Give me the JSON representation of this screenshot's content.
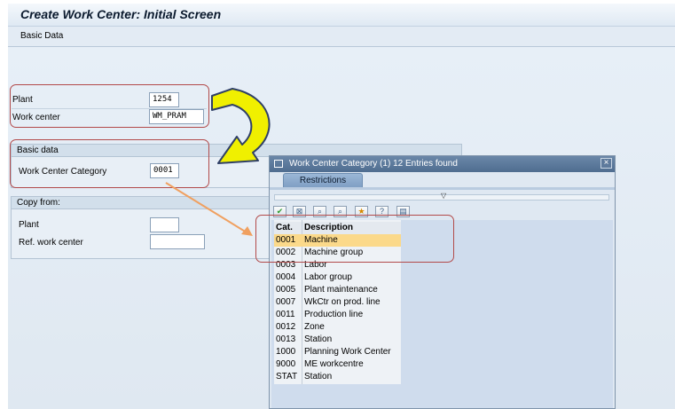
{
  "window": {
    "title": "Create Work Center: Initial Screen"
  },
  "toolbar": {
    "basic_data_label": "Basic Data"
  },
  "form": {
    "plant_label": "Plant",
    "plant_value": "1254",
    "work_center_label": "Work center",
    "work_center_value": "WM_PRAM"
  },
  "basic_data_group": {
    "title": "Basic data",
    "category_label": "Work Center Category",
    "category_value": "0001"
  },
  "copy_from_group": {
    "title": "Copy from:",
    "plant_label": "Plant",
    "plant_value": "",
    "ref_label": "Ref. work center",
    "ref_value": ""
  },
  "popup": {
    "title": "Work Center Category (1)   12 Entries found",
    "close_glyph": "×",
    "tab_label": "Restrictions",
    "toolbar_icons": [
      "checkmark-icon",
      "cancel-icon",
      "search-icon",
      "search-next-icon",
      "favorite-icon",
      "help-icon",
      "print-icon"
    ],
    "columns": {
      "cat": "Cat.",
      "desc": "Description"
    },
    "rows": [
      {
        "cat": "0001",
        "desc": "Machine"
      },
      {
        "cat": "0002",
        "desc": "Machine group"
      },
      {
        "cat": "0003",
        "desc": "Labor"
      },
      {
        "cat": "0004",
        "desc": "Labor group"
      },
      {
        "cat": "0005",
        "desc": "Plant maintenance"
      },
      {
        "cat": "0007",
        "desc": "WkCtr on prod. line"
      },
      {
        "cat": "0011",
        "desc": "Production line"
      },
      {
        "cat": "0012",
        "desc": "Zone"
      },
      {
        "cat": "0013",
        "desc": "Station"
      },
      {
        "cat": "1000",
        "desc": "Planning Work Center"
      },
      {
        "cat": "9000",
        "desc": "ME workcentre"
      },
      {
        "cat": "STAT",
        "desc": "Station"
      }
    ]
  },
  "annotations": {
    "box_color": "#b24a4a",
    "arrow_curve_color": "#f0f000",
    "arrow_line_color": "#f0a060"
  }
}
